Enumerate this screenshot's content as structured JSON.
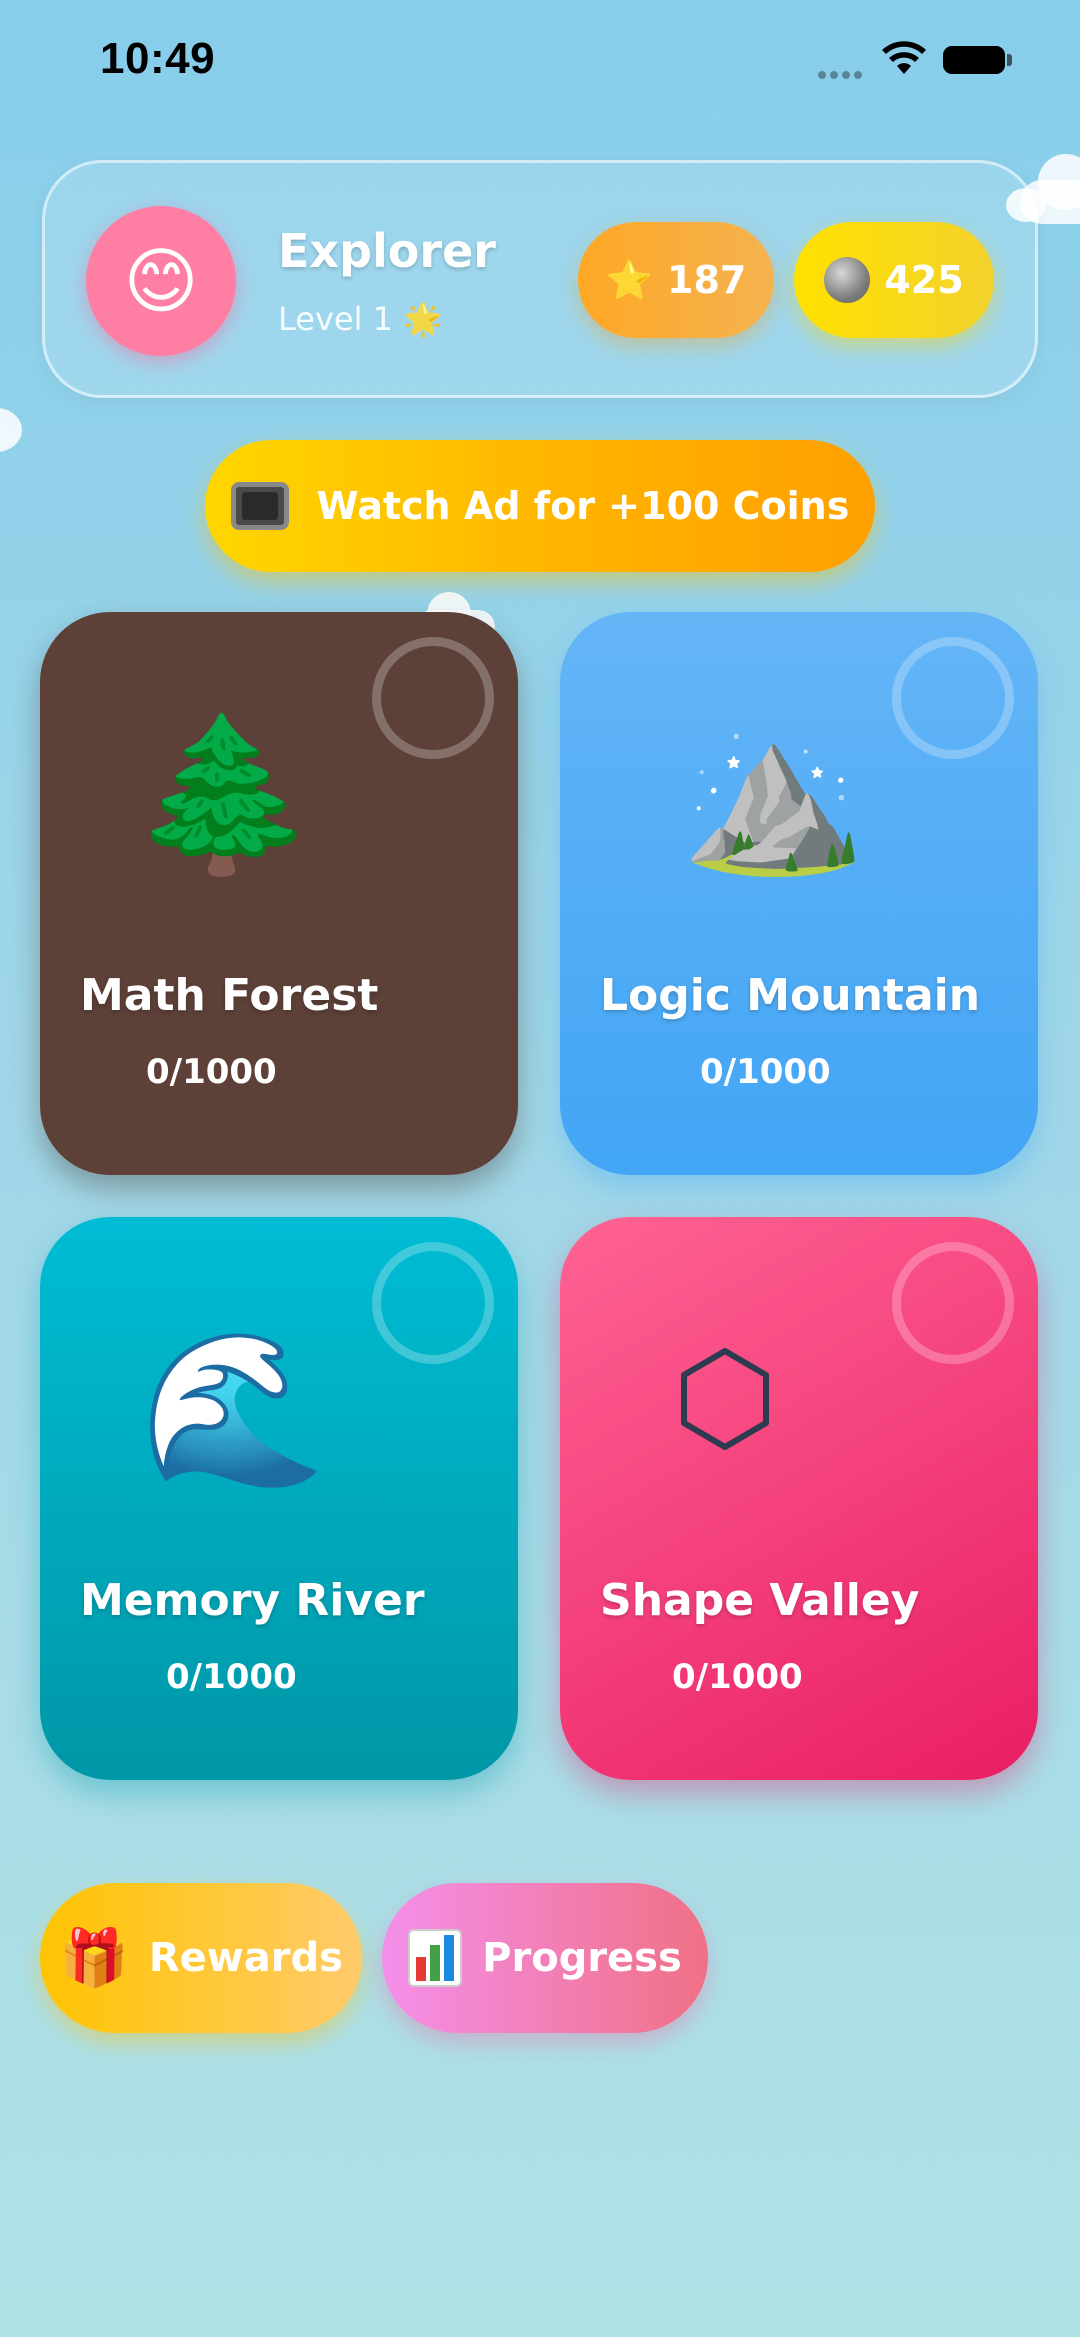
{
  "status_bar": {
    "time": "10:49"
  },
  "profile": {
    "avatar_emoji": "😊",
    "name": "Explorer",
    "level": "Level 1 🌟",
    "stars": {
      "icon": "⭐",
      "value": "187"
    },
    "coins": {
      "icon": "coin-icon",
      "value": "425"
    }
  },
  "ad_button": {
    "icon": "📺",
    "label": "Watch Ad for +100 Coins"
  },
  "worlds": [
    {
      "emoji": "🌲",
      "title": "Math Forest",
      "progress": "0/1000",
      "color": "#5D4037"
    },
    {
      "emoji": "⛰️",
      "title": "Logic Mountain",
      "progress": "0/1000",
      "color": "#42A5F5"
    },
    {
      "emoji": "🌊",
      "title": "Memory River",
      "progress": "0/1000",
      "color": "#00ACC1"
    },
    {
      "emoji": "hexagon-icon",
      "title": "Shape Valley",
      "progress": "0/1000",
      "color": "#E91E63"
    }
  ],
  "bottom_nav": {
    "rewards": {
      "icon": "🎁",
      "label": "Rewards"
    },
    "progress": {
      "icon": "bar-chart-icon",
      "label": "Progress"
    }
  }
}
